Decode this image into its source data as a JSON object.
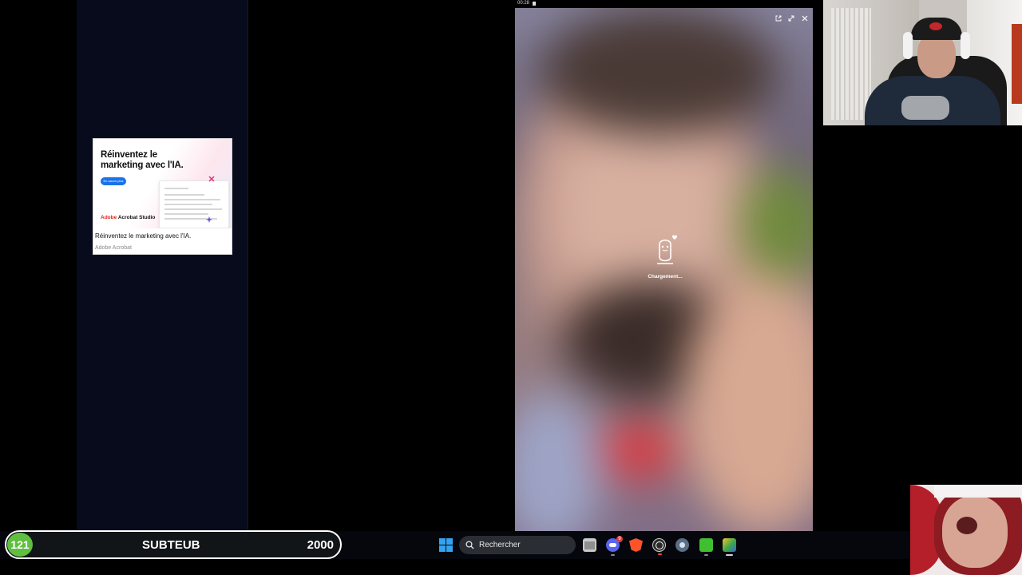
{
  "ad": {
    "headline": "Réinventez le marketing avec l'IA.",
    "button_label": "En savoir plus",
    "brand_prefix": "Adobe",
    "brand_product": "Acrobat Studio",
    "caption": "Réinventez le marketing avec l'IA.",
    "source": "Adobe Acrobat"
  },
  "video": {
    "timestamp": "00:28",
    "loading_text": "Chargement...",
    "controls": [
      "external-link-icon",
      "expand-icon",
      "close-icon"
    ]
  },
  "score": {
    "badge": "121",
    "name": "SUBTEUB",
    "value": "2000",
    "badge_color": "#5fbf3f"
  },
  "taskbar": {
    "search_placeholder": "Rechercher",
    "discord_badge": "9",
    "icons": [
      "windows-start-icon",
      "search-icon",
      "file-explorer-icon",
      "discord-icon",
      "brave-icon",
      "obs-icon",
      "settings-icon",
      "notepad-icon",
      "layers-app-icon"
    ]
  }
}
